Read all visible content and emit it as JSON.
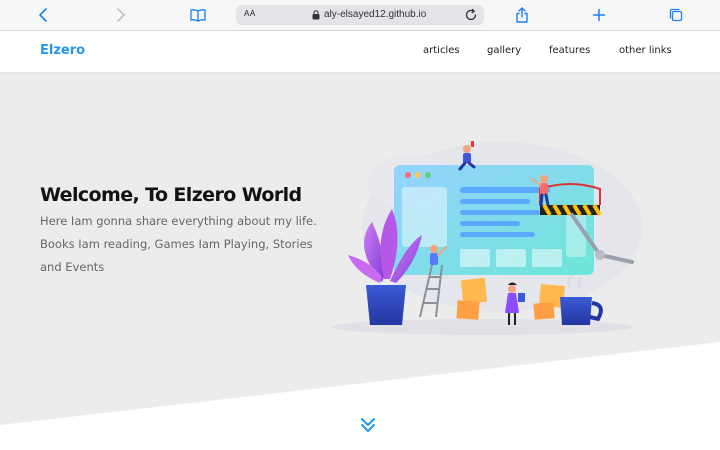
{
  "browser": {
    "url_aa": "AA",
    "url": "aly-elsayed12.github.io",
    "icons": [
      "back-icon",
      "forward-icon",
      "book-icon",
      "lock-icon",
      "reload-icon",
      "share-icon",
      "plus-icon",
      "tabs-icon"
    ]
  },
  "header": {
    "logo": "Elzero",
    "nav": [
      "articles",
      "gallery",
      "features",
      "other links"
    ]
  },
  "hero": {
    "title": "Welcome, To Elzero World",
    "description": "Here Iam gonna share everything about my life. Books Iam reading, Games Iam Playing, Stories and Events"
  },
  "colors": {
    "accent": "#2196f3",
    "landing_bg": "#ececec",
    "browser_bg": "#f7f7f7"
  },
  "scroll_icon": "double-chevron-down-icon"
}
